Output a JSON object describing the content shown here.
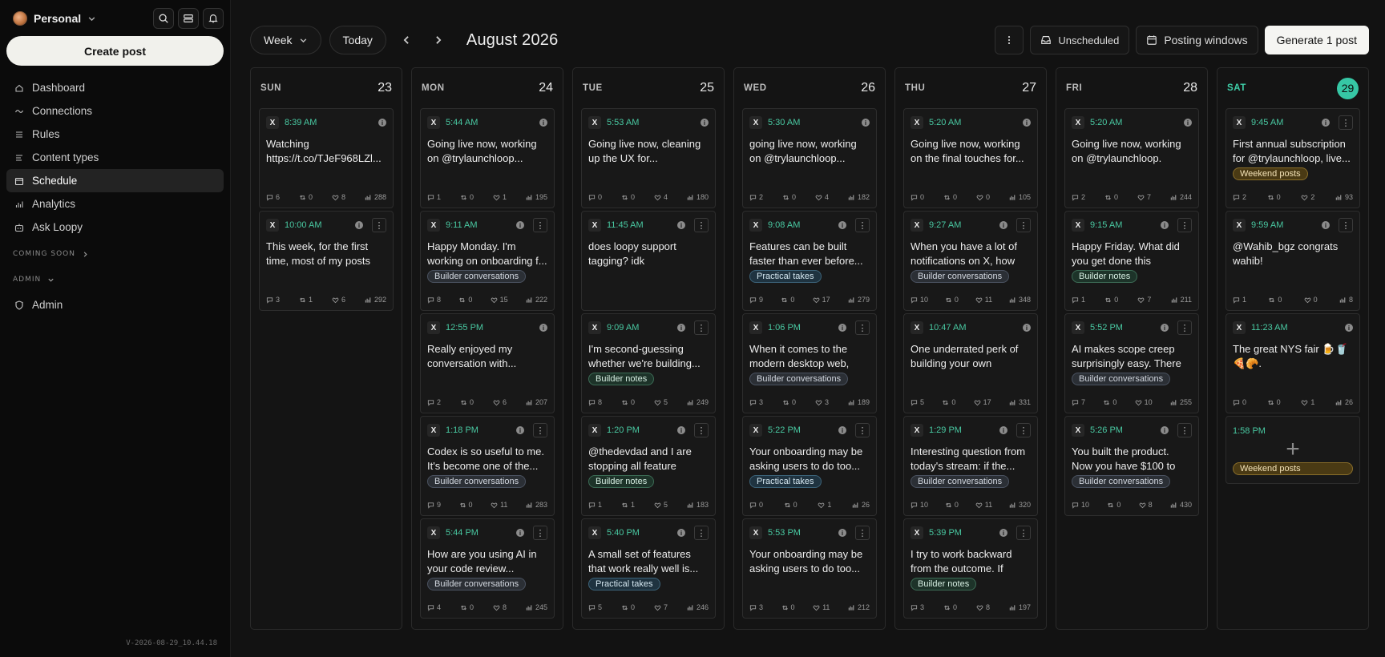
{
  "workspace": {
    "name": "Personal"
  },
  "sidebar": {
    "create_label": "Create post",
    "items": [
      {
        "label": "Dashboard",
        "icon": "home-icon"
      },
      {
        "label": "Connections",
        "icon": "link-icon"
      },
      {
        "label": "Rules",
        "icon": "list-icon"
      },
      {
        "label": "Content types",
        "icon": "lines-icon"
      },
      {
        "label": "Schedule",
        "icon": "calendar-icon",
        "active": true
      },
      {
        "label": "Analytics",
        "icon": "chart-icon"
      },
      {
        "label": "Ask Loopy",
        "icon": "bot-icon"
      }
    ],
    "coming_soon": "COMING SOON",
    "admin_section": "ADMIN",
    "admin_item": "Admin",
    "version": "V-2026-08-29_10.44.18"
  },
  "toolbar": {
    "view": "Week",
    "today": "Today",
    "month": "August 2026",
    "unscheduled": "Unscheduled",
    "posting_windows": "Posting windows",
    "generate": "Generate 1 post"
  },
  "days": [
    {
      "dow": "SUN",
      "num": "23",
      "posts": [
        {
          "time": "8:39 AM",
          "text": "Watching https://t.co/TJeF968LZl...",
          "tag": "",
          "tagType": "",
          "more": false,
          "stats": [
            "6",
            "0",
            "8",
            "288"
          ]
        },
        {
          "time": "10:00 AM",
          "text": "This week, for the first time, most of my posts o...",
          "tag": "",
          "tagType": "",
          "more": true,
          "stats": [
            "3",
            "1",
            "6",
            "292"
          ]
        }
      ]
    },
    {
      "dow": "MON",
      "num": "24",
      "posts": [
        {
          "time": "5:44 AM",
          "text": "Going live now, working on @trylaunchloop...",
          "tag": "",
          "tagType": "",
          "more": false,
          "stats": [
            "1",
            "0",
            "1",
            "195"
          ]
        },
        {
          "time": "9:11 AM",
          "text": "Happy Monday. I'm working on onboarding f...",
          "tag": "Builder conversations",
          "tagType": "bc",
          "more": true,
          "stats": [
            "8",
            "0",
            "15",
            "222"
          ]
        },
        {
          "time": "12:55 PM",
          "text": "Really enjoyed my conversation with...",
          "tag": "",
          "tagType": "",
          "more": false,
          "stats": [
            "2",
            "0",
            "6",
            "207"
          ]
        },
        {
          "time": "1:18 PM",
          "text": "Codex is so useful to me. It's become one of the...",
          "tag": "Builder conversations",
          "tagType": "bc",
          "more": true,
          "stats": [
            "9",
            "0",
            "11",
            "283"
          ]
        },
        {
          "time": "5:44 PM",
          "text": "How are you using AI in your code review...",
          "tag": "Builder conversations",
          "tagType": "bc",
          "more": true,
          "stats": [
            "4",
            "0",
            "8",
            "245"
          ]
        }
      ]
    },
    {
      "dow": "TUE",
      "num": "25",
      "posts": [
        {
          "time": "5:53 AM",
          "text": "Going live now, cleaning up the UX for...",
          "tag": "",
          "tagType": "",
          "more": false,
          "stats": [
            "0",
            "0",
            "4",
            "180"
          ]
        },
        {
          "time": "11:45 AM",
          "text": "does loopy support tagging? idk @thedevda...",
          "tag": "",
          "tagType": "",
          "more": true,
          "stats": []
        },
        {
          "time": "9:09 AM",
          "text": "I'm second-guessing whether we're building...",
          "tag": "Builder notes",
          "tagType": "bn",
          "more": true,
          "stats": [
            "8",
            "0",
            "5",
            "249"
          ]
        },
        {
          "time": "1:20 PM",
          "text": "@thedevdad and I are stopping all feature work...",
          "tag": "Builder notes",
          "tagType": "bn",
          "more": true,
          "stats": [
            "1",
            "1",
            "5",
            "183"
          ]
        },
        {
          "time": "5:40 PM",
          "text": "A small set of features that work really well is...",
          "tag": "Practical takes",
          "tagType": "pt",
          "more": true,
          "stats": [
            "5",
            "0",
            "7",
            "246"
          ]
        }
      ]
    },
    {
      "dow": "WED",
      "num": "26",
      "posts": [
        {
          "time": "5:30 AM",
          "text": "going live now, working on @trylaunchloop...",
          "tag": "",
          "tagType": "",
          "more": false,
          "stats": [
            "2",
            "0",
            "4",
            "182"
          ]
        },
        {
          "time": "9:08 AM",
          "text": "Features can be built faster than ever before...",
          "tag": "Practical takes",
          "tagType": "pt",
          "more": true,
          "stats": [
            "9",
            "0",
            "17",
            "279"
          ]
        },
        {
          "time": "1:06 PM",
          "text": "When it comes to the modern desktop web, do...",
          "tag": "Builder conversations",
          "tagType": "bc",
          "more": true,
          "stats": [
            "3",
            "0",
            "3",
            "189"
          ]
        },
        {
          "time": "5:22 PM",
          "text": "Your onboarding may be asking users to do too...",
          "tag": "Practical takes",
          "tagType": "pt",
          "more": true,
          "stats": [
            "0",
            "0",
            "1",
            "26"
          ]
        },
        {
          "time": "5:53 PM",
          "text": "Your onboarding may be asking users to do too...",
          "tag": "",
          "tagType": "",
          "more": true,
          "stats": [
            "3",
            "0",
            "11",
            "212"
          ]
        }
      ]
    },
    {
      "dow": "THU",
      "num": "27",
      "posts": [
        {
          "time": "5:20 AM",
          "text": "Going live now, working on the final touches for...",
          "tag": "",
          "tagType": "",
          "more": false,
          "stats": [
            "0",
            "0",
            "0",
            "105"
          ]
        },
        {
          "time": "9:27 AM",
          "text": "When you have a lot of notifications on X, how d...",
          "tag": "Builder conversations",
          "tagType": "bc",
          "more": true,
          "stats": [
            "10",
            "0",
            "11",
            "348"
          ]
        },
        {
          "time": "10:47 AM",
          "text": "One underrated perk of building your own SaaS:...",
          "tag": "",
          "tagType": "",
          "more": false,
          "stats": [
            "5",
            "0",
            "17",
            "331"
          ]
        },
        {
          "time": "1:29 PM",
          "text": "Interesting question from today's stream: if the...",
          "tag": "Builder conversations",
          "tagType": "bc",
          "more": true,
          "stats": [
            "10",
            "0",
            "11",
            "320"
          ]
        },
        {
          "time": "5:39 PM",
          "text": "I try to work backward from the outcome. If user...",
          "tag": "Builder notes",
          "tagType": "bn",
          "more": true,
          "stats": [
            "3",
            "0",
            "8",
            "197"
          ]
        }
      ]
    },
    {
      "dow": "FRI",
      "num": "28",
      "posts": [
        {
          "time": "5:20 AM",
          "text": "Going live now, working on @trylaunchloop. Fixin...",
          "tag": "",
          "tagType": "",
          "more": false,
          "stats": [
            "2",
            "0",
            "7",
            "244"
          ]
        },
        {
          "time": "9:15 AM",
          "text": "Happy Friday. What did you get done this week?...",
          "tag": "Builder notes",
          "tagType": "bn",
          "more": true,
          "stats": [
            "1",
            "0",
            "7",
            "211"
          ]
        },
        {
          "time": "5:52 PM",
          "text": "AI makes scope creep surprisingly easy. There i...",
          "tag": "Builder conversations",
          "tagType": "bc",
          "more": true,
          "stats": [
            "7",
            "0",
            "10",
            "255"
          ]
        },
        {
          "time": "5:26 PM",
          "text": "You built the product. Now you have $100 to get...",
          "tag": "Builder conversations",
          "tagType": "bc",
          "more": true,
          "stats": [
            "10",
            "0",
            "8",
            "430"
          ]
        }
      ]
    },
    {
      "dow": "SAT",
      "num": "29",
      "today": true,
      "posts": [
        {
          "time": "9:45 AM",
          "text": "First annual subscription for @trylaunchloop, live...",
          "tag": "Weekend posts",
          "tagType": "wp",
          "more": true,
          "stats": [
            "2",
            "0",
            "2",
            "93"
          ]
        },
        {
          "time": "9:59 AM",
          "text": "@Wahib_bgz congrats wahib!",
          "tag": "",
          "tagType": "",
          "more": true,
          "stats": [
            "1",
            "0",
            "0",
            "8"
          ]
        },
        {
          "time": "11:23 AM",
          "text": "The great NYS fair 🍺🥤🍕🥐.",
          "tag": "",
          "tagType": "",
          "more": false,
          "stats": [
            "0",
            "0",
            "1",
            "26"
          ]
        }
      ],
      "slot": {
        "time": "1:58 PM",
        "tag": "Weekend posts"
      }
    }
  ]
}
